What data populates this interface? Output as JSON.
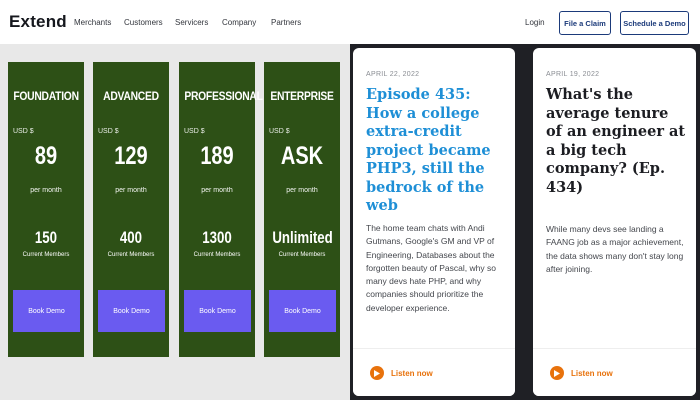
{
  "header": {
    "logo": "Extend",
    "nav": [
      "Merchants",
      "Customers",
      "Servicers",
      "Company",
      "Partners"
    ],
    "login": "Login",
    "file_claim": "File a Claim",
    "schedule_demo": "Schedule a Demo"
  },
  "pricing": {
    "plans": [
      {
        "name": "FOUNDATION",
        "currency": "USD $",
        "price": "89",
        "period": "per month",
        "members": "150",
        "members_label": "Current Members",
        "cta": "Book Demo"
      },
      {
        "name": "ADVANCED",
        "currency": "USD $",
        "price": "129",
        "period": "per month",
        "members": "400",
        "members_label": "Current Members",
        "cta": "Book Demo"
      },
      {
        "name": "PROFESSIONAL",
        "currency": "USD $",
        "price": "189",
        "period": "per month",
        "members": "1300",
        "members_label": "Current Members",
        "cta": "Book Demo"
      },
      {
        "name": "ENTERPRISE",
        "currency": "USD $",
        "price": "ASK",
        "period": "per month",
        "members": "Unlimited",
        "members_label": "Current Members",
        "cta": "Book Demo"
      }
    ]
  },
  "episodes": [
    {
      "date": "APRIL 22, 2022",
      "title": "Episode 435: How a college extra-credit project became PHP3, still the bedrock of the web",
      "summary": "The home team chats with Andi Gutmans, Google's GM and VP of Engineering, Databases about the forgotten beauty of Pascal, why so many devs hate PHP, and why companies should prioritize the developer experience.",
      "listen": "Listen now"
    },
    {
      "date": "APRIL 19, 2022",
      "title": "What's the average tenure of an engineer at a big tech company? (Ep. 434)",
      "summary": "While many devs see landing a FAANG job as a major achievement, the data shows many don't stay long after joining.",
      "listen": "Listen now"
    }
  ],
  "colors": {
    "plan_bg": "#2d5016",
    "cta_bg": "#6a5bf0",
    "accent_blue": "#1e8fd6",
    "listen_orange": "#e8720c",
    "brand_navy": "#1b3a7a"
  },
  "icons": {
    "listen": "play-icon"
  }
}
